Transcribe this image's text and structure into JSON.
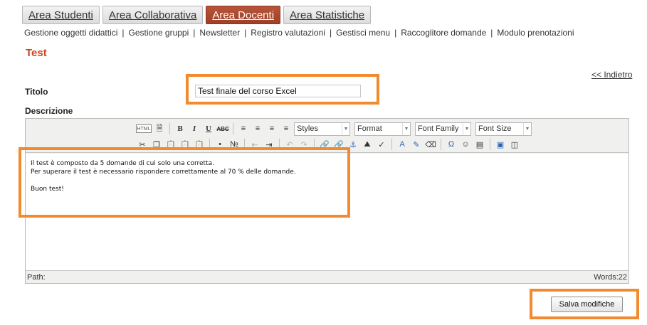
{
  "tabs": [
    {
      "label": "Area Studenti",
      "active": false
    },
    {
      "label": "Area Collaborativa",
      "active": false
    },
    {
      "label": "Area Docenti",
      "active": true
    },
    {
      "label": "Area Statistiche",
      "active": false
    }
  ],
  "subnav": [
    "Gestione oggetti didattici",
    "Gestione gruppi",
    "Newsletter",
    "Registro valutazioni",
    "Gestisci menu",
    "Raccoglitore domande",
    "Modulo prenotazioni"
  ],
  "subnav_separator": "|",
  "page": {
    "title": "Test",
    "back_link": "<< Indietro"
  },
  "form": {
    "title_label": "Titolo",
    "title_value": "Test finale del corso Excel",
    "description_label": "Descrizione",
    "save_label": "Salva modifiche"
  },
  "editor": {
    "html_label": "HTML",
    "bold": "B",
    "italic": "I",
    "underline": "U",
    "strike": "ABC",
    "selects": [
      "Styles",
      "Format",
      "Font Family",
      "Font Size"
    ],
    "content": [
      "Il test è composto da 5 domande di cui solo una corretta.",
      "Per superare il test è necessario rispondere correttamente al 70 % delle domande.",
      "",
      "Buon test!"
    ],
    "path_label": "Path:",
    "words_label": "Words:22"
  },
  "colors": {
    "accent": "#c9441e",
    "active_tab": "#a8452b",
    "highlight": "#f28a2e"
  }
}
